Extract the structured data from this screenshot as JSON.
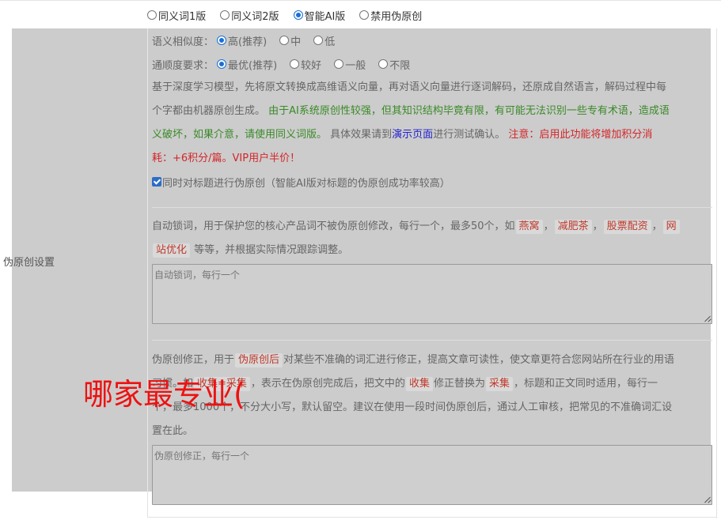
{
  "mode_options": [
    {
      "label": "同义词1版",
      "checked": false
    },
    {
      "label": "同义词2版",
      "checked": false
    },
    {
      "label": "智能AI版",
      "checked": true
    },
    {
      "label": "禁用伪原创",
      "checked": false
    }
  ],
  "side_label": "伪原创设置",
  "similarity": {
    "label": "语义相似度：",
    "options": [
      {
        "label": "高(推荐)",
        "checked": true
      },
      {
        "label": "中",
        "checked": false
      },
      {
        "label": "低",
        "checked": false
      }
    ]
  },
  "fluency": {
    "label": "通顺度要求：",
    "options": [
      {
        "label": "最优(推荐)",
        "checked": true
      },
      {
        "label": "较好",
        "checked": false
      },
      {
        "label": "一般",
        "checked": false
      },
      {
        "label": "不限",
        "checked": false
      }
    ]
  },
  "description": {
    "line1": "基于深度学习模型，先将原文转换成高维语义向量，再对语义向量进行逐词解码，还原成自然语言，解码过程中每",
    "line2_plain": "个字都由机器原创生成。",
    "line2_green": "由于AI系统原创性较强，但其知识结构毕竟有限，有可能无法识别一些专有术语，造成语",
    "line3_green": "义破坏，如果介意，请使用同义词版。",
    "line3_plain_a": "具体效果请到",
    "line3_link": "演示页面",
    "line3_plain_b": "进行测试确认。",
    "line3_red": "注意：启用此功能将增加积分消",
    "line4_red": "耗：+6积分/篇。VIP用户半价！"
  },
  "title_checkbox": {
    "label": "同时对标题进行伪原创（智能AI版对标题的伪原创成功率较高）",
    "checked": true
  },
  "lock_words": {
    "text_a": "自动锁词，用于保护您的核心产品词不被伪原创修改，每行一个，最多50个，如",
    "tags": [
      "燕窝",
      "减肥茶",
      "股票配资",
      "网"
    ],
    "tag_cont": "站优化",
    "text_b": "等等，并根据实际情况跟踪调整。",
    "placeholder": "自动锁词，每行一个"
  },
  "correction": {
    "line1_a": "伪原创修正，用于",
    "line1_tag": "伪原创后",
    "line1_b": "对某些不准确的词汇进行修正，提高文章可读性，使文章更符合您网站所在行业的用语",
    "line2_a": "习惯。如",
    "line2_tag1": "收集=采集",
    "line2_b": "，表示在伪原创完成后，把文中的",
    "line2_tag2": "收集",
    "line2_c": "修正替换为",
    "line2_tag3": "采集",
    "line2_d": "，标题和正文同时适用，每行一",
    "line3": "个，最多1000个，不分大小写，默认留空。建议在使用一段时间伪原创后，通过人工审核，把常见的不准确词汇设",
    "line4": "置在此。",
    "placeholder": "伪原创修正，每行一个"
  },
  "overlay_text": "哪家最专业("
}
